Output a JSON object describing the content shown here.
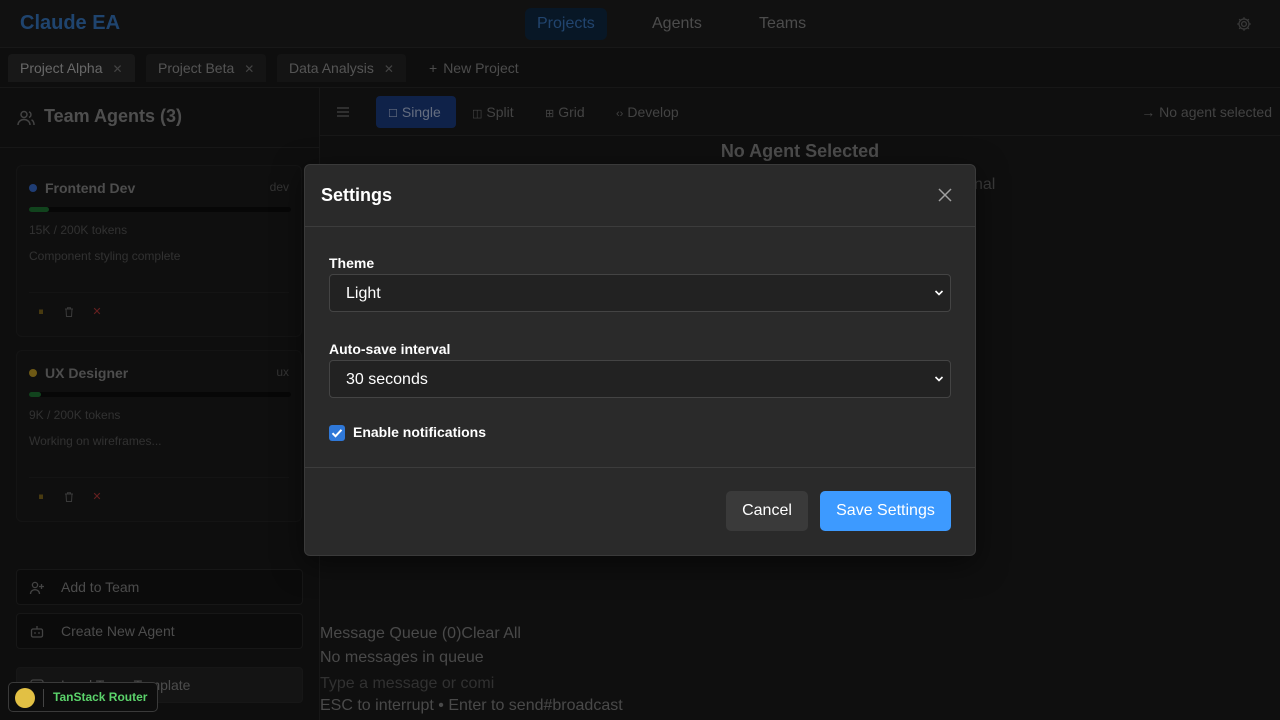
{
  "app": {
    "brand": "Claude EA"
  },
  "nav": {
    "items": [
      {
        "label": "Projects",
        "active": true
      },
      {
        "label": "Agents"
      },
      {
        "label": "Teams"
      }
    ]
  },
  "tabs": [
    {
      "label": "Project Alpha",
      "active": true
    },
    {
      "label": "Project Beta"
    },
    {
      "label": "Data Analysis"
    }
  ],
  "new_project_label": "New Project",
  "sidebar": {
    "title": "Team Agents (3)",
    "agents": [
      {
        "name": "Frontend Dev",
        "role": "dev",
        "tokens": "15K / 200K tokens",
        "status": "Component styling complete",
        "usage_fraction": 0.075,
        "dot_color": "#3a6fd4"
      },
      {
        "name": "UX Designer",
        "role": "ux",
        "tokens": "9K / 200K tokens",
        "status": "Working on wireframes...",
        "usage_fraction": 0.045,
        "dot_color": "#c9a227"
      }
    ],
    "buttons": {
      "add": "Add to Team",
      "create": "Create New Agent",
      "load": "Load Team Template"
    }
  },
  "viewbar": {
    "modes": [
      {
        "label": "Single",
        "active": true
      },
      {
        "label": "Split"
      },
      {
        "label": "Grid"
      },
      {
        "label": "Develop"
      }
    ],
    "no_agent": "No agent selected"
  },
  "main": {
    "title": "No Agent Selected",
    "ghost_text": "nal"
  },
  "queue": {
    "header": "Message Queue (0)Clear All",
    "empty": "No messages in queue",
    "placeholder": "Type a message or comi",
    "hint": "ESC to interrupt • Enter to send#broadcast"
  },
  "settings": {
    "title": "Settings",
    "theme_label": "Theme",
    "theme_value": "Light",
    "autosave_label": "Auto-save interval",
    "autosave_value": "30 seconds",
    "notifications_label": "Enable notifications",
    "notifications_enabled": true,
    "cancel": "Cancel",
    "save": "Save Settings"
  },
  "devtools": {
    "label": "TanStack Router"
  },
  "colors": {
    "accent": "#3d9aff",
    "brand": "#3a7cc9",
    "checkbox": "#2f78d8"
  }
}
